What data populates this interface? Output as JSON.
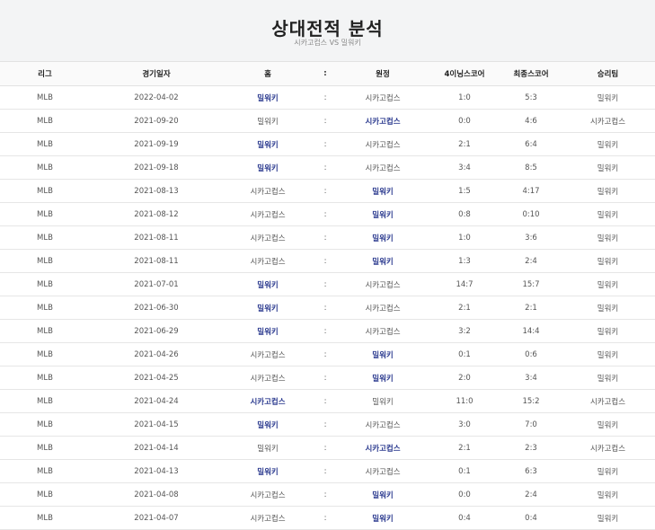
{
  "header": {
    "title": "상대전적 분석",
    "subtitle": "시카고컵스 VS 밀워키"
  },
  "columns": {
    "league": "리그",
    "date": "경기일자",
    "home": "홈",
    "colon": ":",
    "away": "원정",
    "score4": "4이닝스코어",
    "final": "최종스코어",
    "winner": "승리팀"
  },
  "rows": [
    {
      "league": "MLB",
      "date": "2022-04-02",
      "home": "밀워키",
      "away": "시카고컵스",
      "score4": "1:0",
      "final": "5:3",
      "winner": "밀워키",
      "win_side": "home"
    },
    {
      "league": "MLB",
      "date": "2021-09-20",
      "home": "밀워키",
      "away": "시카고컵스",
      "score4": "0:0",
      "final": "4:6",
      "winner": "시카고컵스",
      "win_side": "away"
    },
    {
      "league": "MLB",
      "date": "2021-09-19",
      "home": "밀워키",
      "away": "시카고컵스",
      "score4": "2:1",
      "final": "6:4",
      "winner": "밀워키",
      "win_side": "home"
    },
    {
      "league": "MLB",
      "date": "2021-09-18",
      "home": "밀워키",
      "away": "시카고컵스",
      "score4": "3:4",
      "final": "8:5",
      "winner": "밀워키",
      "win_side": "home"
    },
    {
      "league": "MLB",
      "date": "2021-08-13",
      "home": "시카고컵스",
      "away": "밀워키",
      "score4": "1:5",
      "final": "4:17",
      "winner": "밀워키",
      "win_side": "away"
    },
    {
      "league": "MLB",
      "date": "2021-08-12",
      "home": "시카고컵스",
      "away": "밀워키",
      "score4": "0:8",
      "final": "0:10",
      "winner": "밀워키",
      "win_side": "away"
    },
    {
      "league": "MLB",
      "date": "2021-08-11",
      "home": "시카고컵스",
      "away": "밀워키",
      "score4": "1:0",
      "final": "3:6",
      "winner": "밀워키",
      "win_side": "away"
    },
    {
      "league": "MLB",
      "date": "2021-08-11",
      "home": "시카고컵스",
      "away": "밀워키",
      "score4": "1:3",
      "final": "2:4",
      "winner": "밀워키",
      "win_side": "away"
    },
    {
      "league": "MLB",
      "date": "2021-07-01",
      "home": "밀워키",
      "away": "시카고컵스",
      "score4": "14:7",
      "final": "15:7",
      "winner": "밀워키",
      "win_side": "home"
    },
    {
      "league": "MLB",
      "date": "2021-06-30",
      "home": "밀워키",
      "away": "시카고컵스",
      "score4": "2:1",
      "final": "2:1",
      "winner": "밀워키",
      "win_side": "home"
    },
    {
      "league": "MLB",
      "date": "2021-06-29",
      "home": "밀워키",
      "away": "시카고컵스",
      "score4": "3:2",
      "final": "14:4",
      "winner": "밀워키",
      "win_side": "home"
    },
    {
      "league": "MLB",
      "date": "2021-04-26",
      "home": "시카고컵스",
      "away": "밀워키",
      "score4": "0:1",
      "final": "0:6",
      "winner": "밀워키",
      "win_side": "away"
    },
    {
      "league": "MLB",
      "date": "2021-04-25",
      "home": "시카고컵스",
      "away": "밀워키",
      "score4": "2:0",
      "final": "3:4",
      "winner": "밀워키",
      "win_side": "away"
    },
    {
      "league": "MLB",
      "date": "2021-04-24",
      "home": "시카고컵스",
      "away": "밀워키",
      "score4": "11:0",
      "final": "15:2",
      "winner": "시카고컵스",
      "win_side": "home"
    },
    {
      "league": "MLB",
      "date": "2021-04-15",
      "home": "밀워키",
      "away": "시카고컵스",
      "score4": "3:0",
      "final": "7:0",
      "winner": "밀워키",
      "win_side": "home"
    },
    {
      "league": "MLB",
      "date": "2021-04-14",
      "home": "밀워키",
      "away": "시카고컵스",
      "score4": "2:1",
      "final": "2:3",
      "winner": "시카고컵스",
      "win_side": "away"
    },
    {
      "league": "MLB",
      "date": "2021-04-13",
      "home": "밀워키",
      "away": "시카고컵스",
      "score4": "0:1",
      "final": "6:3",
      "winner": "밀워키",
      "win_side": "home"
    },
    {
      "league": "MLB",
      "date": "2021-04-08",
      "home": "시카고컵스",
      "away": "밀워키",
      "score4": "0:0",
      "final": "2:4",
      "winner": "밀워키",
      "win_side": "away"
    },
    {
      "league": "MLB",
      "date": "2021-04-07",
      "home": "시카고컵스",
      "away": "밀워키",
      "score4": "0:4",
      "final": "0:4",
      "winner": "밀워키",
      "win_side": "away"
    }
  ],
  "colors": {
    "winner_text": "#2b3a8f",
    "header_bg": "#f3f4f5"
  }
}
